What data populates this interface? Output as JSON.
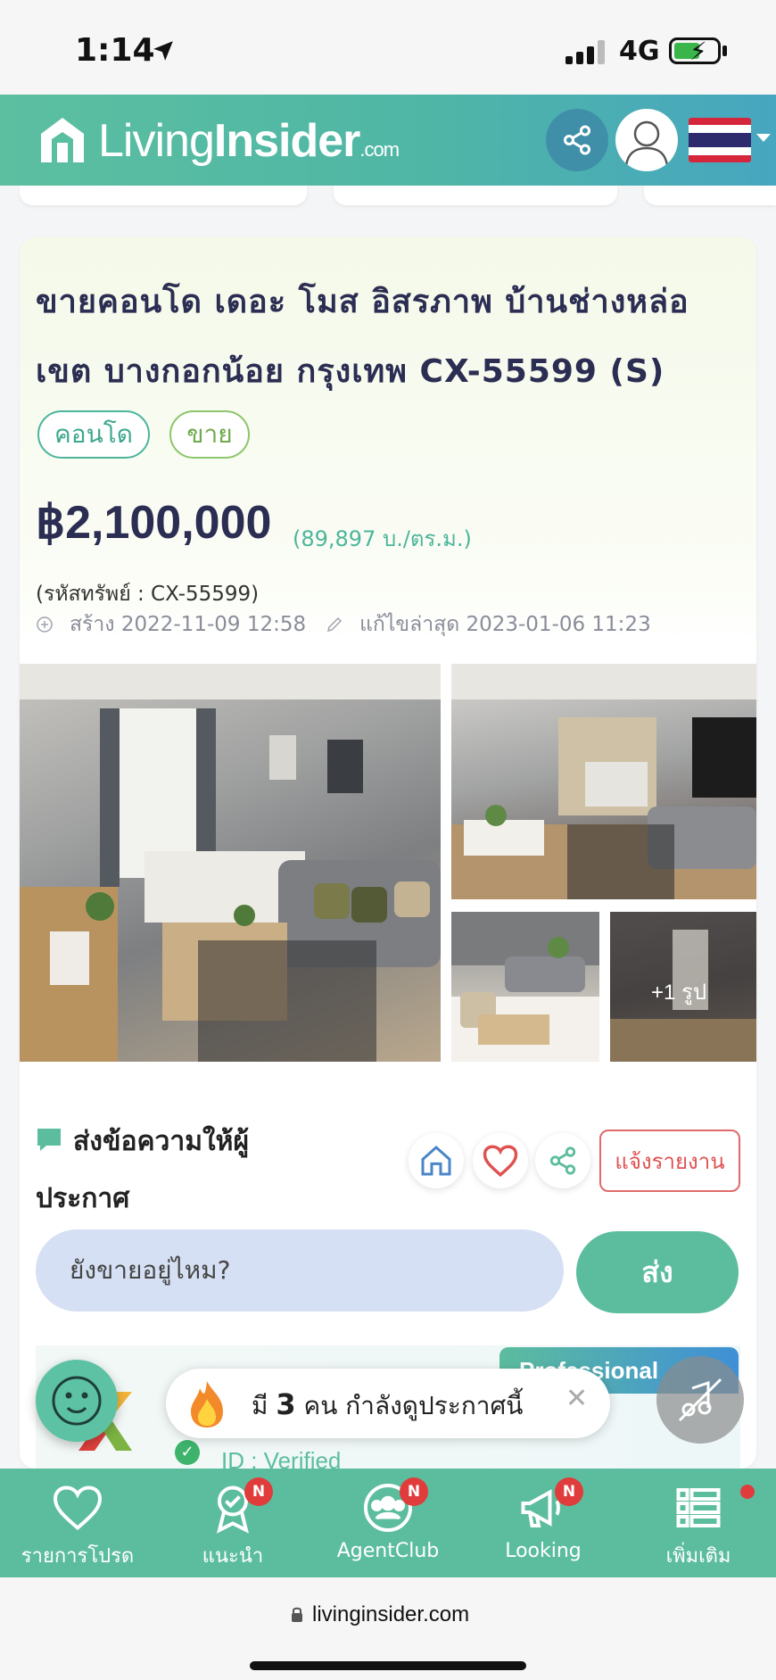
{
  "status": {
    "time": "1:14",
    "network": "4G"
  },
  "header": {
    "logo_living": "Living",
    "logo_insider": "Insider",
    "logo_tld": ".com"
  },
  "listing": {
    "title_line1": "ขายคอนโด เดอะ โมส อิสรภาพ บ้านช่างหล่อ",
    "title_line2": "เขต บางกอกน้อย กรุงเทพ CX-55599 (S)",
    "tags": [
      "คอนโด",
      "ขาย"
    ],
    "price": "฿2,100,000",
    "price_per_sqm": "(89,897 บ./ตร.ม.)",
    "property_code": "(รหัสทรัพย์ : CX-55599)",
    "created": "สร้าง 2022-11-09 12:58",
    "edited": "แก้ไขล่าสุด 2023-01-06 11:23",
    "more_photos": "+1 รูป"
  },
  "message": {
    "title": "ส่งข้อความให้ผู้ประกาศ",
    "report_label": "แจ้งรายงาน",
    "input_value": "ยังขายอยู่ไหม?",
    "send_label": "ส่ง"
  },
  "agent": {
    "badge": "Professional",
    "verified": "ID : Verified"
  },
  "toast": {
    "prefix": "มี ",
    "count": "3",
    "suffix": " คน กำลังดูประกาศนี้",
    "close": "✕"
  },
  "nav": {
    "items": [
      {
        "label": "รายการโปรด",
        "badge": ""
      },
      {
        "label": "แนะนำ",
        "badge": "N"
      },
      {
        "label": "AgentClub",
        "badge": "N"
      },
      {
        "label": "Looking",
        "badge": "N"
      },
      {
        "label": "เพิ่มเติม",
        "badge": ""
      }
    ]
  },
  "browser": {
    "url": "livinginsider.com"
  },
  "colors": {
    "brand_green": "#5cbd9e",
    "brand_blue": "#47a6c0",
    "title_navy": "#2b2d52",
    "report_red": "#e05252",
    "badge_red": "#e03c3c"
  },
  "icons": [
    "location-arrow-icon",
    "share-icon",
    "user-avatar-icon",
    "thailand-flag-icon",
    "plus-circle-icon",
    "pencil-icon",
    "chat-bubble-icon",
    "home-icon",
    "heart-icon",
    "close-icon",
    "smile-face-icon",
    "fire-icon",
    "mute-icon",
    "award-icon",
    "group-icon",
    "megaphone-icon",
    "menu-list-icon",
    "lock-icon"
  ]
}
